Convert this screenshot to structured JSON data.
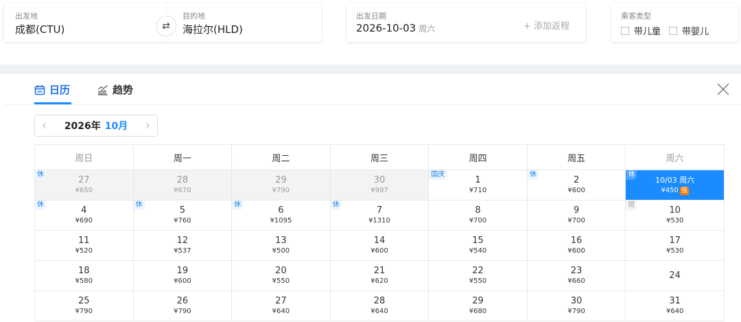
{
  "route": {
    "from_label": "出发地",
    "from_value": "成都(CTU)",
    "to_label": "目的地",
    "to_value": "海拉尔(HLD)",
    "swap_glyph": "⇄"
  },
  "date": {
    "label": "出发日期",
    "value": "2026-10-03",
    "weekday": "周六",
    "add_return": "+ 添加返程"
  },
  "passenger": {
    "label": "乘客类型",
    "options": [
      "带儿童",
      "带婴儿"
    ]
  },
  "tabs": [
    {
      "label": "日历",
      "icon": "calendar-icon"
    },
    {
      "label": "趋势",
      "icon": "trend-chart-icon"
    }
  ],
  "month_nav": {
    "year": "2026年",
    "month": "10月",
    "prev": "‹",
    "next": "›"
  },
  "weekdays": [
    "周日",
    "周一",
    "周二",
    "周三",
    "周四",
    "周五",
    "周六"
  ],
  "colors": {
    "accent": "#1a8cff",
    "low_badge": "#ff7a00"
  },
  "calendar": [
    [
      {
        "day": "27",
        "price": "¥650",
        "tag": "休",
        "past": true
      },
      {
        "day": "28",
        "price": "¥670",
        "past": true
      },
      {
        "day": "29",
        "price": "¥790",
        "past": true
      },
      {
        "day": "30",
        "price": "¥997",
        "past": true
      },
      {
        "day": "1",
        "price": "¥710",
        "tag": "国庆"
      },
      {
        "day": "2",
        "price": "¥600",
        "tag": "休"
      },
      {
        "day": "10/03 周六",
        "price": "¥450",
        "tag": "休",
        "selected": true,
        "low": "低"
      }
    ],
    [
      {
        "day": "4",
        "price": "¥690",
        "tag": "休"
      },
      {
        "day": "5",
        "price": "¥760",
        "tag": "休"
      },
      {
        "day": "6",
        "price": "¥1095",
        "tag": "休"
      },
      {
        "day": "7",
        "price": "¥1310",
        "tag": "休"
      },
      {
        "day": "8",
        "price": "¥700"
      },
      {
        "day": "9",
        "price": "¥700"
      },
      {
        "day": "10",
        "price": "¥530",
        "tag": "班"
      }
    ],
    [
      {
        "day": "11",
        "price": "¥520"
      },
      {
        "day": "12",
        "price": "¥537"
      },
      {
        "day": "13",
        "price": "¥500"
      },
      {
        "day": "14",
        "price": "¥600"
      },
      {
        "day": "15",
        "price": "¥540"
      },
      {
        "day": "16",
        "price": "¥600"
      },
      {
        "day": "17",
        "price": "¥530"
      }
    ],
    [
      {
        "day": "18",
        "price": "¥580"
      },
      {
        "day": "19",
        "price": "¥600"
      },
      {
        "day": "20",
        "price": "¥550"
      },
      {
        "day": "21",
        "price": "¥620"
      },
      {
        "day": "22",
        "price": "¥550"
      },
      {
        "day": "23",
        "price": "¥660"
      },
      {
        "day": "24",
        "price": ""
      }
    ],
    [
      {
        "day": "25",
        "price": "¥790"
      },
      {
        "day": "26",
        "price": "¥790"
      },
      {
        "day": "27",
        "price": "¥640"
      },
      {
        "day": "28",
        "price": "¥640"
      },
      {
        "day": "29",
        "price": "¥680"
      },
      {
        "day": "30",
        "price": "¥790"
      },
      {
        "day": "31",
        "price": "¥640"
      }
    ]
  ]
}
